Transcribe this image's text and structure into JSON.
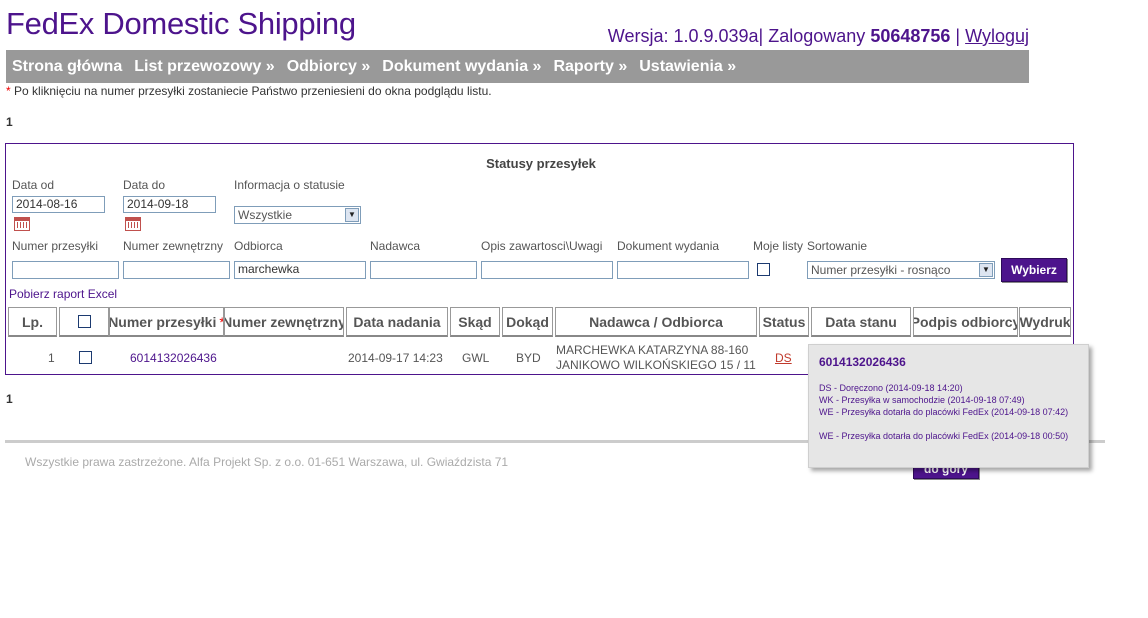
{
  "header": {
    "brand": "FedEx Domestic Shipping",
    "version_label": "Wersja: 1.0.9.039a|",
    "logged_label": "Zalogowany",
    "user_id": "50648756",
    "separator": "|",
    "logout": "Wyloguj"
  },
  "nav": [
    "Strona główna",
    "List przewozowy »",
    "Odbiorcy »",
    "Dokument wydania »",
    "Raporty »",
    "Ustawienia »"
  ],
  "note": {
    "star": "*",
    "text": "Po kliknięciu na numer przesyłki zostaniecie Państwo przeniesieni do okna podglądu listu."
  },
  "page_top": "1",
  "page_bottom": "1",
  "panel": {
    "title": "Statusy przesyłek",
    "filters": {
      "date_from_label": "Data od",
      "date_from_value": "2014-08-16",
      "date_to_label": "Data do",
      "date_to_value": "2014-09-18",
      "status_label": "Informacja o statusie",
      "status_value": "Wszystkie",
      "parcel_number_label": "Numer przesyłki",
      "parcel_number_value": "",
      "external_number_label": "Numer zewnętrzny",
      "external_number_value": "",
      "recipient_label": "Odbiorca",
      "recipient_value": "marchewka",
      "sender_label": "Nadawca",
      "sender_value": "",
      "content_label": "Opis zawartosci\\Uwagi",
      "content_value": "",
      "document_label": "Dokument wydania",
      "document_value": "",
      "my_lists_label": "Moje listy",
      "sort_label": "Sortowanie",
      "sort_value": "Numer przesyłki - rosnąco",
      "submit": "Wybierz"
    },
    "excel_link": "Pobierz raport Excel",
    "columns": [
      "Lp.",
      "",
      "Numer przesyłki",
      "Numer zewnętrzny",
      "Data nadania",
      "Skąd",
      "Dokąd",
      "Nadawca / Odbiorca",
      "Status",
      "Data stanu",
      "Podpis odbiorcy",
      "Wydruk"
    ],
    "column_star": "*",
    "rows": [
      {
        "lp": "1",
        "parcel_number": "6014132026436",
        "external_number": "",
        "send_date": "2014-09-17 14:23",
        "from": "GWL",
        "to": "BYD",
        "party_line1": "MARCHEWKA KATARZYNA 88-160",
        "party_line2": "JANIKOWO WILKOŃSKIEGO 15 / 11",
        "status": "DS"
      }
    ]
  },
  "tooltip": {
    "title": "6014132026436",
    "entries": [
      "DS - Doręczono (2014-09-18 14:20)",
      "WK - Przesyłka w samochodzie (2014-09-18 07:49)",
      "WE - Przesyłka dotarła do placówki FedEx (2014-09-18 07:42)",
      "WE - Przesyłka dotarła do placówki FedEx (2014-09-18 00:50)"
    ]
  },
  "footer": {
    "copyright": "Wszystkie prawa zastrzeżone. Alfa Projekt Sp. z o.o. 01-651 Warszawa, ul. Gwiaździsta 71",
    "top_button": "do góry"
  },
  "colors": {
    "brand": "#4d148c",
    "nav_bg": "#999999",
    "status_link": "#c0392b"
  }
}
